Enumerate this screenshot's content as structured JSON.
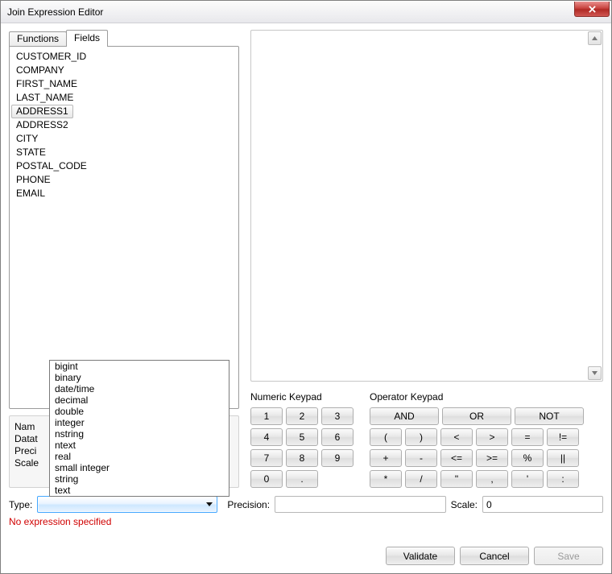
{
  "window": {
    "title": "Join Expression Editor"
  },
  "tabs": {
    "functions": "Functions",
    "fields": "Fields",
    "active": "fields"
  },
  "fields": [
    "CUSTOMER_ID",
    "COMPANY",
    "FIRST_NAME",
    "LAST_NAME",
    "ADDRESS1",
    "ADDRESS2",
    "CITY",
    "STATE",
    "POSTAL_CODE",
    "PHONE",
    "EMAIL"
  ],
  "selected_field": "ADDRESS1",
  "prop_labels": {
    "name": "Nam",
    "datatype": "Datat",
    "precision": "Preci",
    "scale": "Scale"
  },
  "type_options": [
    "bigint",
    "binary",
    "date/time",
    "decimal",
    "double",
    "integer",
    "nstring",
    "ntext",
    "real",
    "small integer",
    "string",
    "text"
  ],
  "keypads": {
    "numeric_label": "Numeric Keypad",
    "operator_label": "Operator Keypad",
    "numeric": [
      "1",
      "2",
      "3",
      "4",
      "5",
      "6",
      "7",
      "8",
      "9",
      "0",
      "."
    ],
    "logical": [
      "AND",
      "OR",
      "NOT"
    ],
    "ops": [
      "(",
      ")",
      "<",
      ">",
      "=",
      "!=",
      "+",
      "-",
      "<=",
      ">=",
      "%",
      "||",
      "*",
      "/",
      "\"",
      ",",
      "'",
      ":"
    ]
  },
  "metabar": {
    "type_label": "Type:",
    "precision_label": "Precision:",
    "precision_value": "",
    "scale_label": "Scale:",
    "scale_value": "0"
  },
  "status": "No expression specified",
  "buttons": {
    "validate": "Validate",
    "cancel": "Cancel",
    "save": "Save"
  }
}
